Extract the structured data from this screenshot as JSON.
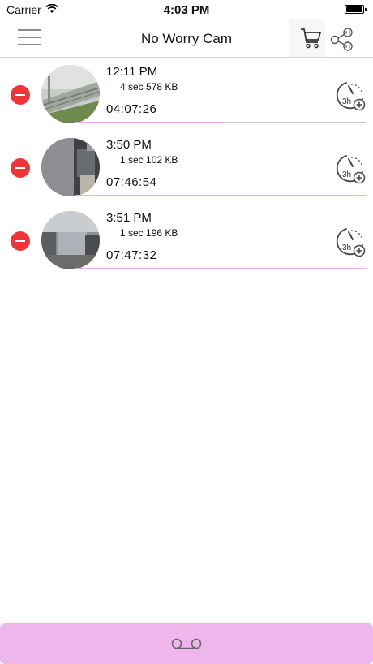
{
  "status_bar": {
    "carrier": "Carrier",
    "time": "4:03 PM"
  },
  "nav": {
    "title": "No Worry Cam",
    "icons": [
      "menu-icon",
      "cart-icon",
      "share-icon"
    ]
  },
  "colors": {
    "delete": "#f0353a",
    "progress": "#eaaee6",
    "bottom_bar": "#eeb6ec",
    "track": "#c4c4c4"
  },
  "recordings": [
    {
      "time": "12:11 PM",
      "meta": "4 sec 578 KB",
      "duration": "04:07:26",
      "progress": 0.51
    },
    {
      "time": "3:50 PM",
      "meta": "1 sec 102 KB",
      "duration": "07:46:54",
      "progress": 1.0
    },
    {
      "time": "3:51 PM",
      "meta": "1 sec 196 KB",
      "duration": "07:47:32",
      "progress": 1.0
    }
  ],
  "bottom_bar": {
    "icon": "voicemail-icon"
  }
}
